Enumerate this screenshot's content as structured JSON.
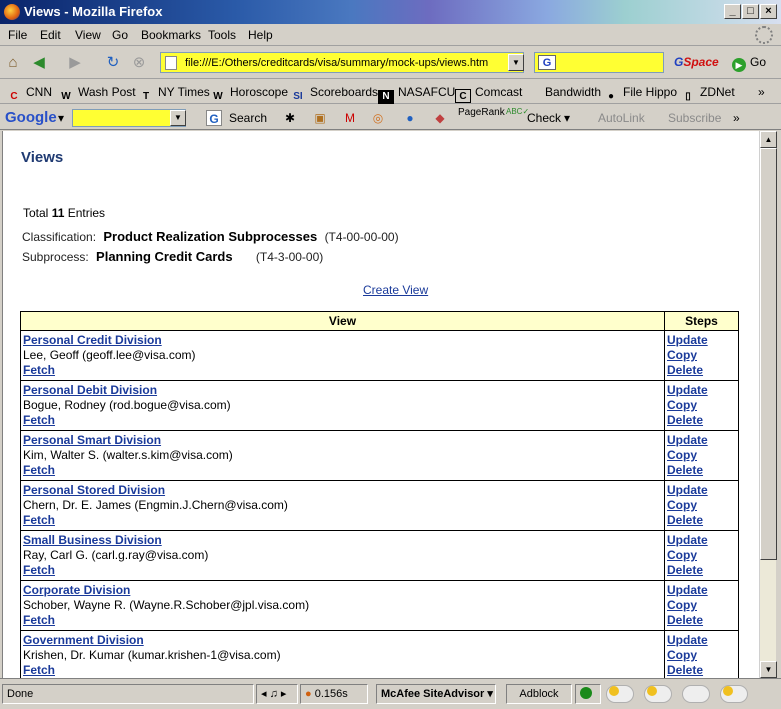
{
  "window": {
    "title": "Views - Mozilla Firefox"
  },
  "menu": [
    "File",
    "Edit",
    "View",
    "Go",
    "Bookmarks",
    "Tools",
    "Help"
  ],
  "nav": {
    "url": "file:///E:/Others/creditcards/visa/summary/mock-ups/views.htm",
    "gspace_g": "G",
    "gspace_rest": "Space",
    "go_label": "Go"
  },
  "bookmarks": [
    "CNN",
    "Wash Post",
    "NY Times",
    "Horoscope",
    "Scoreboards",
    "NASAFCU",
    "Comcast",
    "Bandwidth",
    "File Hippo",
    "ZDNet"
  ],
  "google_toolbar": {
    "logo": "Google",
    "search": "Search",
    "pagerank": "PageRank",
    "check": "Check",
    "autolink": "AutoLink",
    "subscribe": "Subscribe"
  },
  "page": {
    "title": "Views",
    "total_prefix": "Total ",
    "total_count": "11",
    "total_suffix": " Entries",
    "classification_label": "Classification:",
    "classification_value": "Product Realization Subprocesses",
    "classification_code": "(T4-00-00-00)",
    "subprocess_label": "Subprocess:",
    "subprocess_value": "Planning Credit Cards",
    "subprocess_code": "(T4-3-00-00)",
    "create_view": "Create View",
    "col_view": "View",
    "col_steps": "Steps",
    "step_update": "Update",
    "step_copy": "Copy",
    "step_delete": "Delete",
    "fetch": "Fetch",
    "rows": [
      {
        "division": "Personal Credit Division ",
        "owner": "Lee, Geoff (geoff.lee@visa.com)"
      },
      {
        "division": "Personal Debit Division",
        "owner": "Bogue, Rodney (rod.bogue@visa.com)"
      },
      {
        "division": "Personal Smart Division ",
        "owner": "Kim, Walter S. (walter.s.kim@visa.com)"
      },
      {
        "division": "Personal Stored Division",
        "owner": "Chern, Dr. E. James (Engmin.J.Chern@visa.com)"
      },
      {
        "division": "Small Business Division",
        "owner": "Ray, Carl G. (carl.g.ray@visa.com)"
      },
      {
        "division": "Corporate Division",
        "owner": "Schober, Wayne R. (Wayne.R.Schober@jpl.visa.com)"
      },
      {
        "division": "Government Division",
        "owner": "Krishen, Dr. Kumar (kumar.krishen-1@visa.com)"
      }
    ]
  },
  "status": {
    "text": "Done",
    "timing": "0.156s",
    "siteadvisor": "McAfee SiteAdvisor",
    "adblock": "Adblock"
  }
}
